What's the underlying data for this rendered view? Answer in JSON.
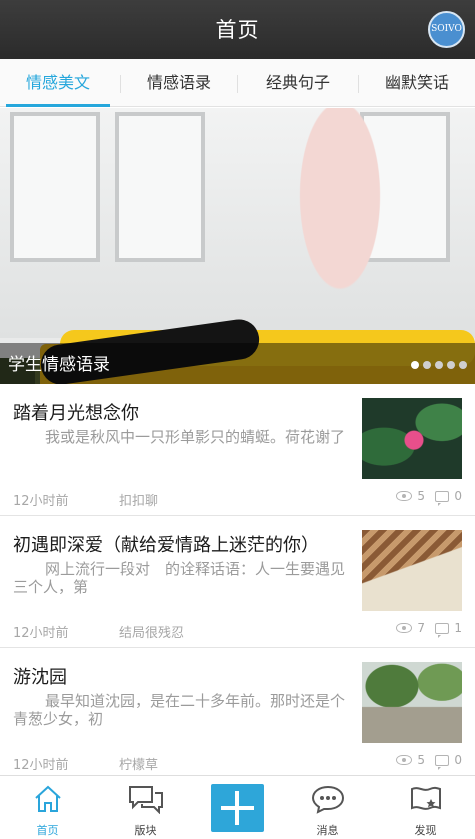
{
  "header": {
    "title": "首页",
    "avatar_text": "SOIVO"
  },
  "tabs": [
    {
      "label": "情感美文",
      "active": true
    },
    {
      "label": "情感语录",
      "active": false
    },
    {
      "label": "经典句子",
      "active": false
    },
    {
      "label": "幽默笑话",
      "active": false
    }
  ],
  "banner": {
    "caption": "学生情感语录",
    "dot_count": 5,
    "active_dot": 1
  },
  "articles": [
    {
      "title": "踏着月光想念你",
      "summary": "我或是秋风中一只形单影只的蜻蜓。荷花谢了",
      "time": "12小时前",
      "author": "扣扣聊",
      "views": "5",
      "comments": "0",
      "thumb_icon": "lotus-thumbnail"
    },
    {
      "title": "初遇即深爱（献给爱情路上迷茫的你）",
      "summary": "网上流行一段对　的诠释话语：人一生要遇见三个人，第",
      "time": "12小时前",
      "author": "结局很残忍",
      "views": "7",
      "comments": "1",
      "thumb_icon": "bench-thumbnail"
    },
    {
      "title": "游沈园",
      "summary": "最早知道沈园，是在二十多年前。那时还是个青葱少女，初",
      "time": "12小时前",
      "author": "柠檬草",
      "views": "5",
      "comments": "0",
      "thumb_icon": "park-thumbnail"
    }
  ],
  "bottom_nav": [
    {
      "label": "首页",
      "icon": "home-icon",
      "active": true
    },
    {
      "label": "版块",
      "icon": "chat-bubbles-icon",
      "active": false
    },
    {
      "label": "",
      "icon": "plus-icon",
      "active": false
    },
    {
      "label": "消息",
      "icon": "message-icon",
      "active": false
    },
    {
      "label": "发现",
      "icon": "discover-flag-icon",
      "active": false
    }
  ],
  "colors": {
    "accent": "#26a7dc",
    "header_bg": "#333333",
    "muted_text": "#9b9b9b"
  }
}
